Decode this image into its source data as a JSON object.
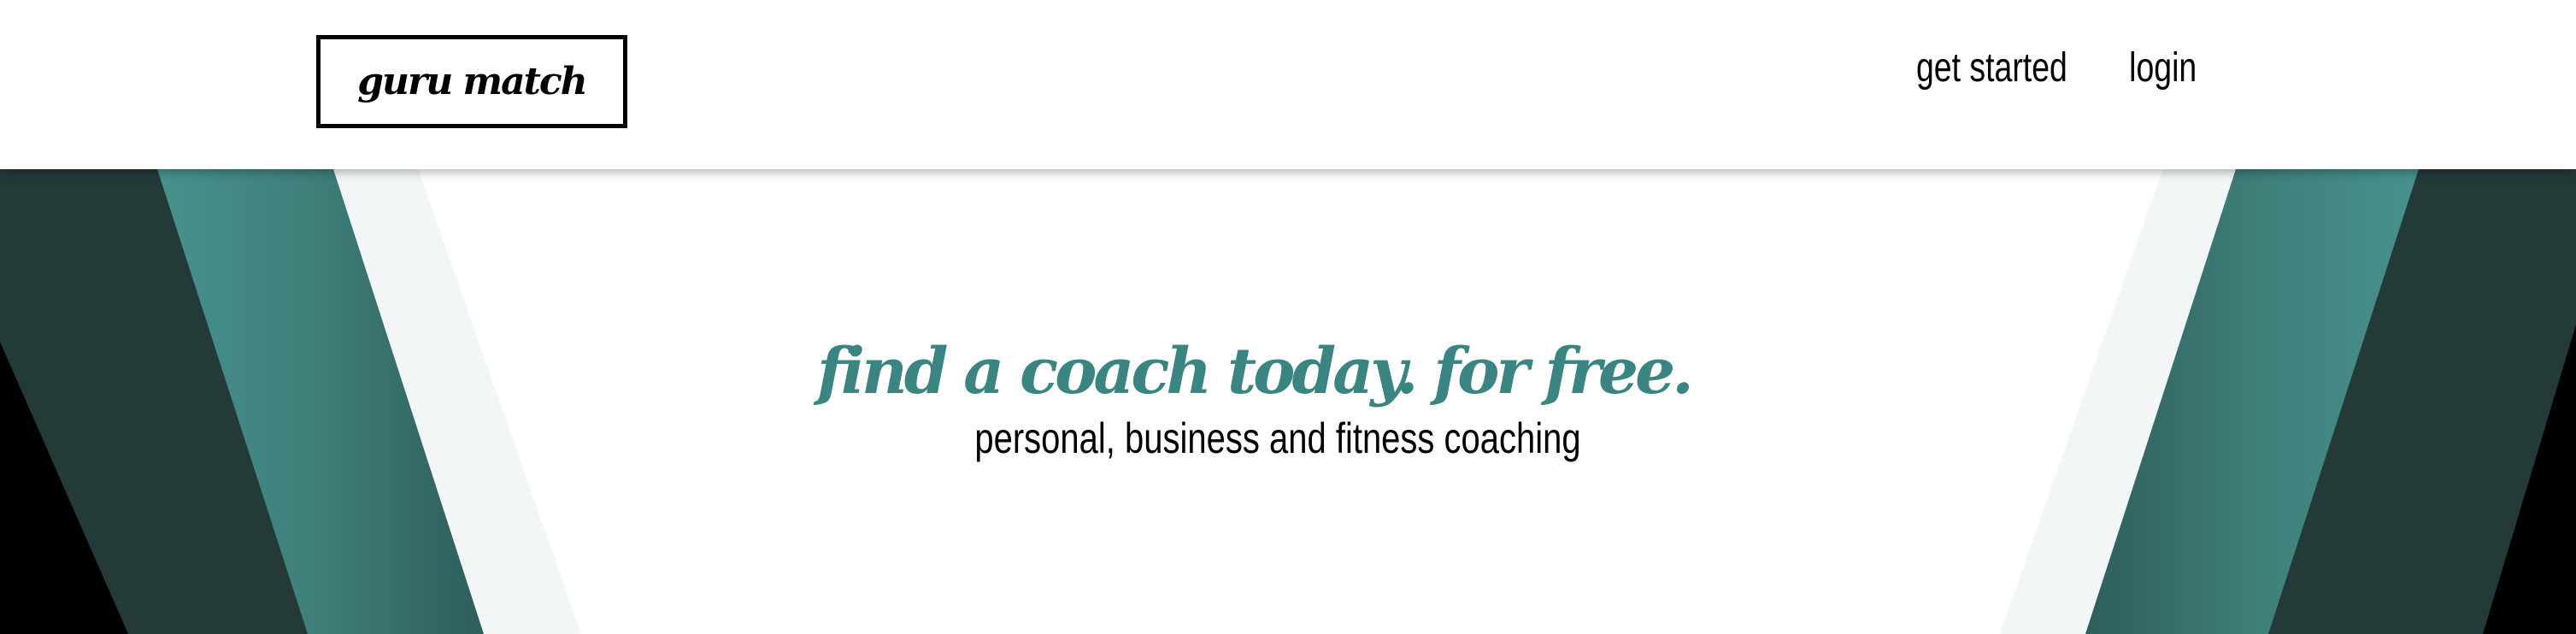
{
  "header": {
    "logo_text": "guru match",
    "nav": {
      "get_started": "get started",
      "login": "login"
    }
  },
  "hero": {
    "title": "find a coach today. for free.",
    "subtitle": "personal, business and fitness coaching"
  },
  "colors": {
    "accent_teal": "#3a8582",
    "dark_teal": "#243a38",
    "stripe_teal": "#4a9893",
    "black": "#000000"
  }
}
